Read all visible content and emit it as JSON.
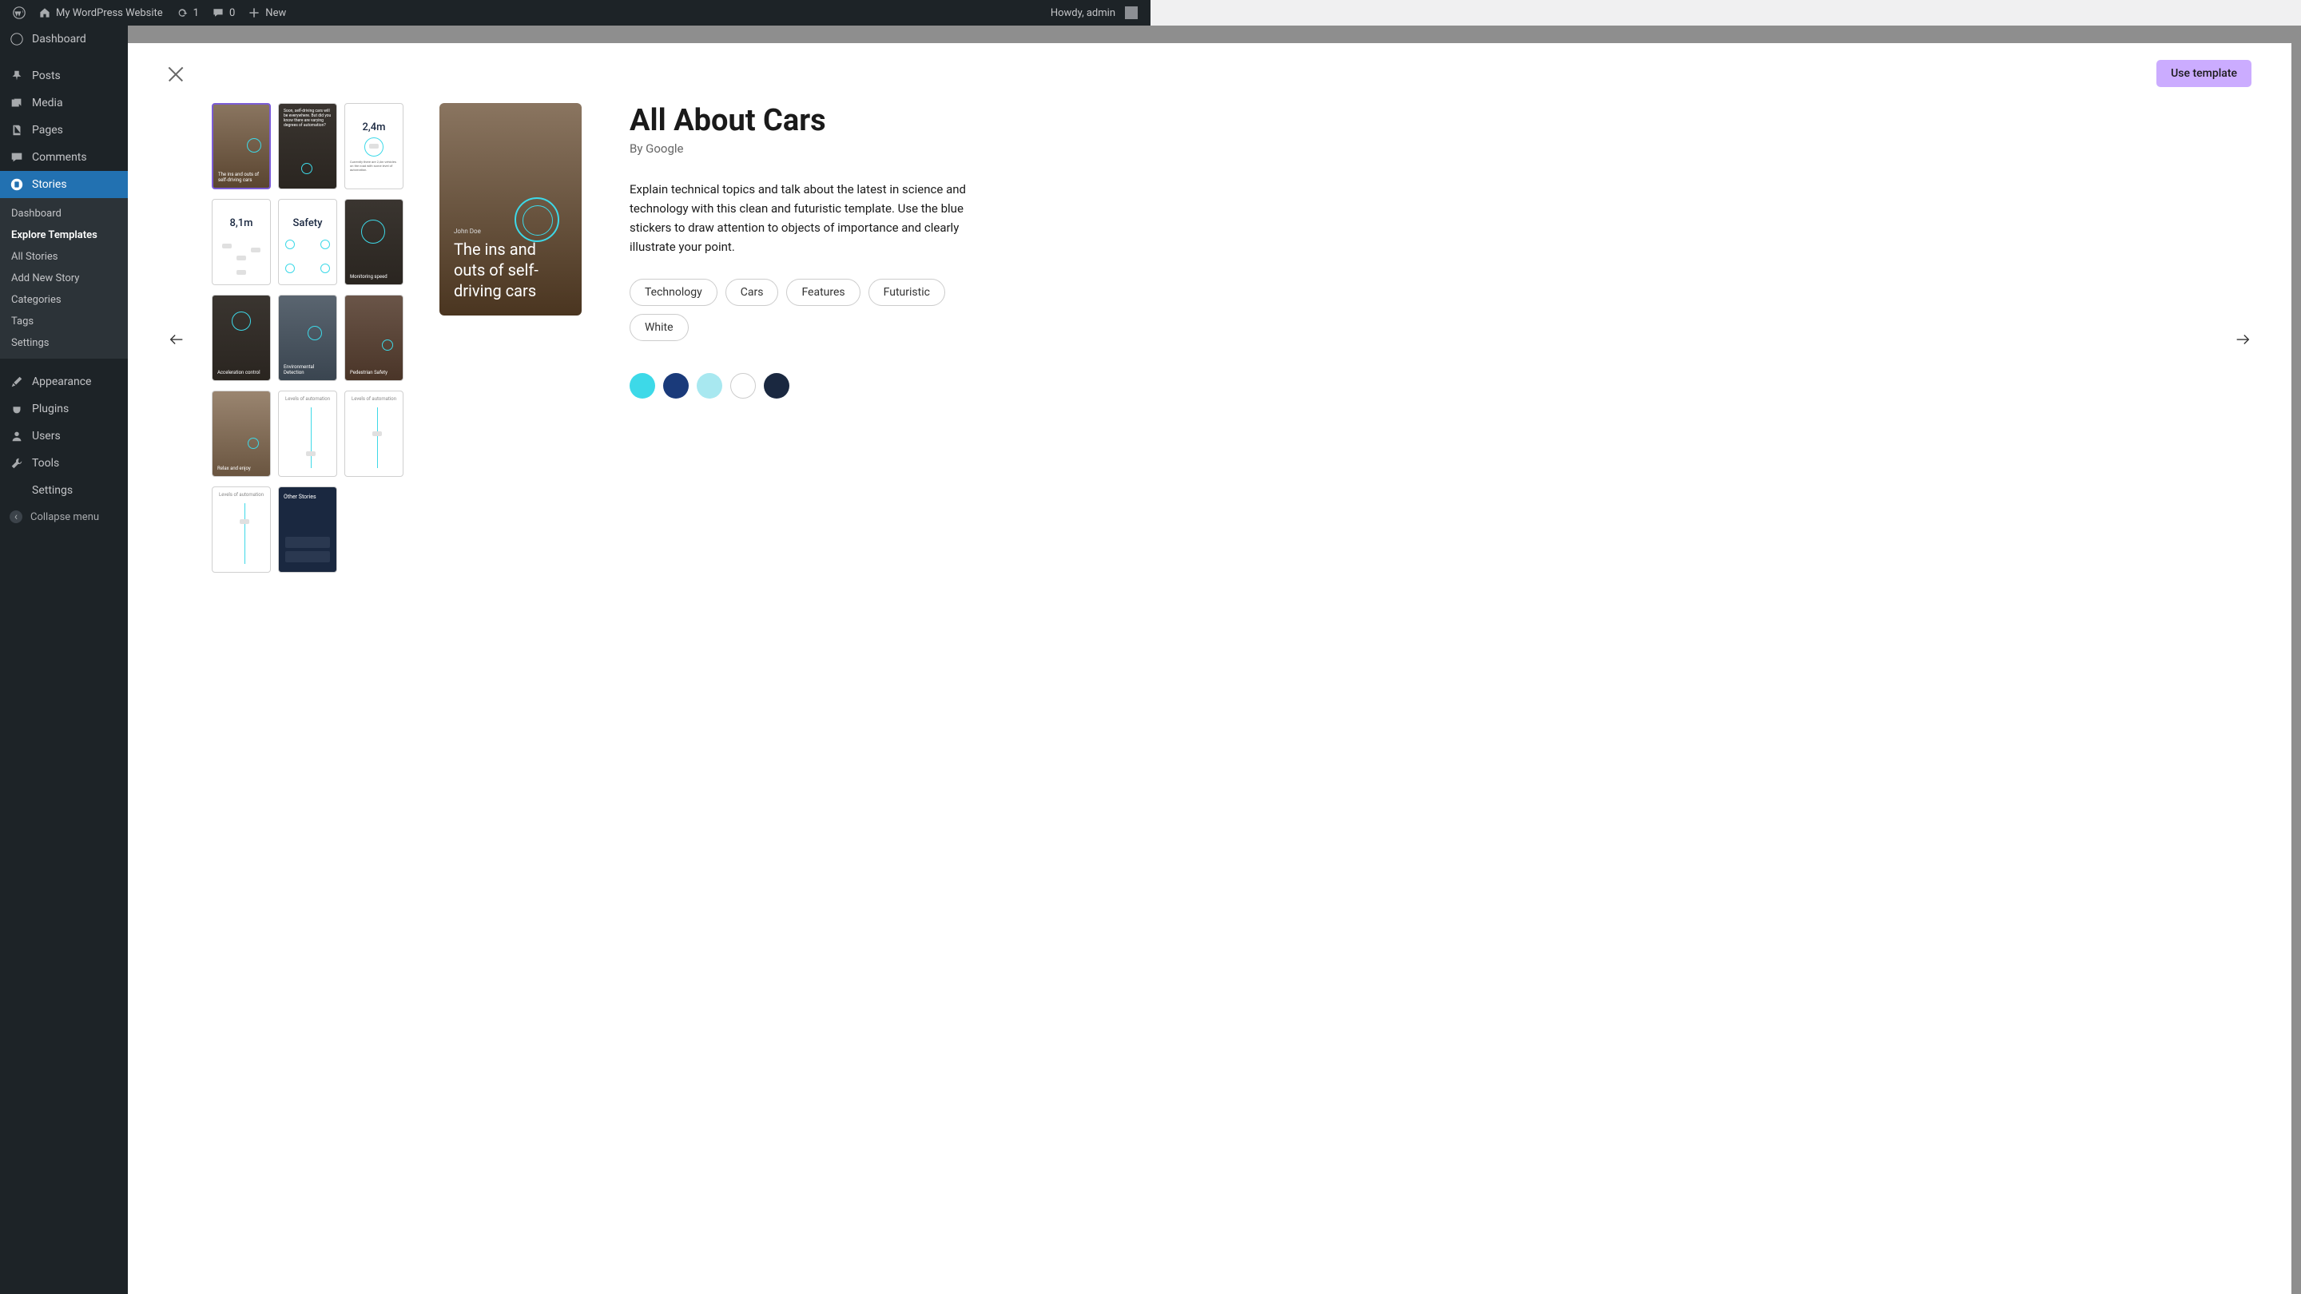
{
  "adminbar": {
    "site_name": "My WordPress Website",
    "updates_count": "1",
    "comments_count": "0",
    "new_label": "New",
    "howdy": "Howdy, admin"
  },
  "sidebar": {
    "dashboard": "Dashboard",
    "posts": "Posts",
    "media": "Media",
    "pages": "Pages",
    "comments": "Comments",
    "stories": "Stories",
    "appearance": "Appearance",
    "plugins": "Plugins",
    "users": "Users",
    "tools": "Tools",
    "settings": "Settings",
    "collapse": "Collapse menu",
    "stories_sub": {
      "dashboard": "Dashboard",
      "explore": "Explore Templates",
      "all": "All Stories",
      "add": "Add New Story",
      "categories": "Categories",
      "tags": "Tags",
      "settings": "Settings"
    }
  },
  "modal": {
    "use_template": "Use template",
    "title": "All About Cars",
    "byline": "By Google",
    "description": "Explain technical topics and talk about the latest in science and technology with this clean and futuristic template. Use the blue stickers to draw attention to objects of importance and clearly illustrate your point.",
    "tags": [
      "Technology",
      "Cars",
      "Features",
      "Futuristic",
      "White"
    ],
    "colors": [
      "#3dd9e8",
      "#1a3a7a",
      "#a8e8f0",
      "#ffffff",
      "#1a2840"
    ],
    "preview": {
      "author": "John Doe",
      "title": "The ins and outs of self-driving cars"
    },
    "thumbs": [
      {
        "type": "city",
        "label": "The ins and outs of self-driving cars"
      },
      {
        "type": "dark",
        "label": "Soon, self-driving cars will be everywhere. But did you know there are varying degrees of automation?"
      },
      {
        "type": "white",
        "center": "2,4m",
        "small": "Currently there are 2,4m vehicles on the road with some level of automation."
      },
      {
        "type": "white",
        "center": "8,1m"
      },
      {
        "type": "white",
        "center": "Safety"
      },
      {
        "type": "dark",
        "label": "Monitoring speed"
      },
      {
        "type": "dark",
        "label": "Acceleration control"
      },
      {
        "type": "dark",
        "label": "Environmental Detection"
      },
      {
        "type": "dark",
        "label": "Pedestrian Safety"
      },
      {
        "type": "city",
        "label": "Relax and enjoy"
      },
      {
        "type": "white",
        "top": "Levels of automation"
      },
      {
        "type": "white",
        "top": "Levels of automation"
      },
      {
        "type": "white",
        "top": "Levels of automation"
      },
      {
        "type": "navy",
        "label": "Other Stories"
      }
    ]
  }
}
